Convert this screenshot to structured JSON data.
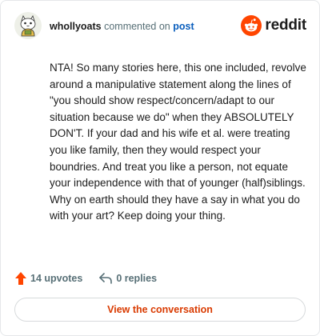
{
  "comment": {
    "username": "whollyoats",
    "commented_on_text": "commented on",
    "post_link": "post",
    "body": "NTA! So many stories here, this one included, revolve around a manipulative statement along the lines of \"you should show respect/concern/adapt to our situation because we do\" when they ABSOLUTELY DON'T. If your dad and his wife et al. were treating you like family, then they would respect your boundries. And treat you like a person, not equate your independence with that of younger (half)siblings. Why on earth should they have a say in what you do with your art? Keep doing your thing."
  },
  "brand": {
    "name": "reddit",
    "color": "#ff4500"
  },
  "actions": {
    "upvotes": "14 upvotes",
    "replies": "0 replies"
  },
  "cta": {
    "label": "View the conversation",
    "color": "#d93a00"
  },
  "icons": {
    "avatar": "avatar-icon",
    "brand": "reddit-logo-icon",
    "upvote": "upvote-arrow-icon",
    "reply": "reply-arrow-icon"
  }
}
